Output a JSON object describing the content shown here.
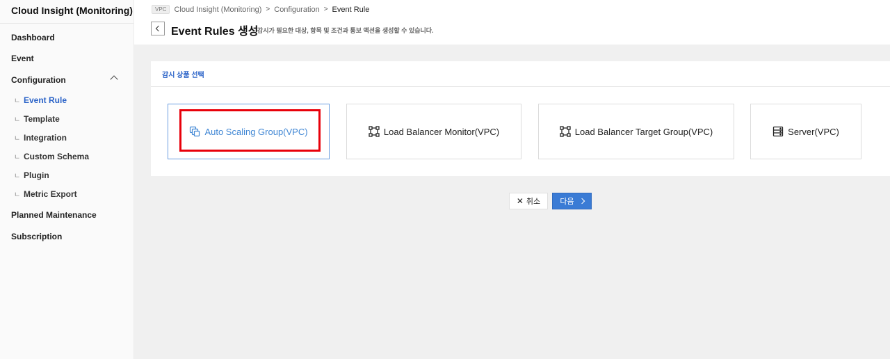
{
  "sidebar": {
    "title": "Cloud Insight (Monitoring)",
    "items": {
      "dashboard": "Dashboard",
      "event": "Event",
      "configuration": "Configuration",
      "planned_maintenance": "Planned Maintenance",
      "subscription": "Subscription"
    },
    "sub_items": [
      "Event Rule",
      "Template",
      "Integration",
      "Custom Schema",
      "Plugin",
      "Metric Export"
    ],
    "bullet": "ㄴ"
  },
  "header": {
    "vpc_tag": "VPC",
    "breadcrumb": [
      "Cloud Insight (Monitoring)",
      "Configuration",
      "Event Rule"
    ],
    "title": "Event Rules 생성",
    "description": "감시가 필요한 대상, 항목 및 조건과 통보 액션을 생성할 수 있습니다."
  },
  "panel": {
    "heading": "감시 상품 선택",
    "products": [
      {
        "label": "Auto Scaling Group(VPC)",
        "icon": "auto-scaling-icon",
        "selected": true
      },
      {
        "label": "Load Balancer Monitor(VPC)",
        "icon": "load-balancer-icon",
        "selected": false
      },
      {
        "label": "Load Balancer Target Group(VPC)",
        "icon": "target-group-icon",
        "selected": false
      },
      {
        "label": "Server(VPC)",
        "icon": "server-icon",
        "selected": false
      }
    ]
  },
  "actions": {
    "cancel_label": "취소",
    "next_label": "다음"
  },
  "colors": {
    "accent": "#2c64c8",
    "primary_button": "#3a7bd5",
    "highlight": "#e8000a",
    "selected_text": "#3f86d4"
  }
}
